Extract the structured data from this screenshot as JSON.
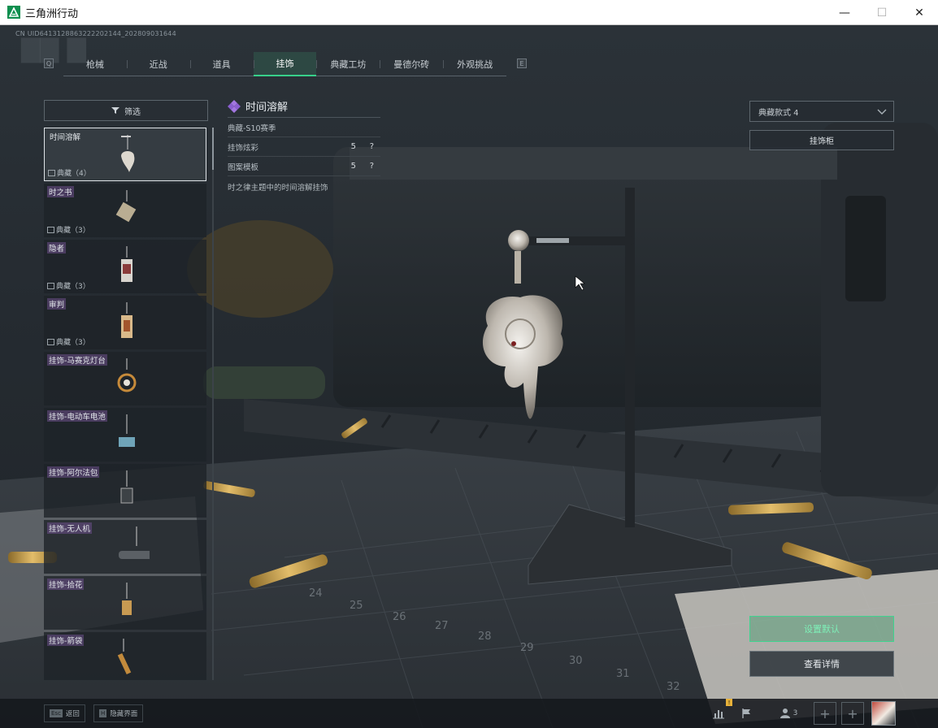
{
  "window": {
    "title": "三角洲行动",
    "controls": [
      "—",
      "☐",
      "✕"
    ]
  },
  "uid": "CN UID6413128863222202144_202809031644",
  "tabbar": {
    "left_key": "Q",
    "right_key": "E",
    "tabs": [
      "枪械",
      "近战",
      "道具",
      "挂饰",
      "典藏工坊",
      "曼德尔砖",
      "外观挑战"
    ],
    "active_index": 3
  },
  "filter": {
    "label": "筛选"
  },
  "list": {
    "items": [
      {
        "name": "时间溶解",
        "rarity": "典藏（4）",
        "selected": true
      },
      {
        "name": "时之书",
        "rarity": "典藏（3）"
      },
      {
        "name": "隐者",
        "rarity": "典藏（3）"
      },
      {
        "name": "审判",
        "rarity": "典藏（3）"
      },
      {
        "name": "挂饰-马赛克灯台",
        "rarity": ""
      },
      {
        "name": "挂饰-电动车电池",
        "rarity": ""
      },
      {
        "name": "挂饰-阿尔法包",
        "rarity": ""
      },
      {
        "name": "挂饰-无人机",
        "rarity": ""
      },
      {
        "name": "挂饰-拾花",
        "rarity": ""
      },
      {
        "name": "挂饰-箭袋",
        "rarity": ""
      }
    ]
  },
  "info": {
    "title": "时间溶解",
    "season": "典藏-S10赛季",
    "rows": [
      {
        "label": "挂饰炫彩",
        "value": "5",
        "help": "?"
      },
      {
        "label": "图案模板",
        "value": "5",
        "help": "?"
      }
    ],
    "description": "时之律主题中的时间溶解挂饰"
  },
  "right": {
    "style_dropdown": "典藏款式 4",
    "cabinet_button": "挂饰柜",
    "set_default_button": "设置默认",
    "details_button": "查看详情"
  },
  "bottom": {
    "back_key": "Esc",
    "back_label": "返回",
    "hide_key": "H",
    "hide_label": "隐藏界面",
    "friends_count": "3",
    "notification_badge": "!"
  },
  "colors": {
    "accent": "#37d08a",
    "rarity_tag": "#6e508c"
  },
  "icons": [
    "app-logo-icon",
    "filter-icon",
    "diamond-icon",
    "chevron-down-icon",
    "image-icon",
    "stats-icon",
    "flag-icon",
    "friends-icon",
    "plus-icon"
  ]
}
